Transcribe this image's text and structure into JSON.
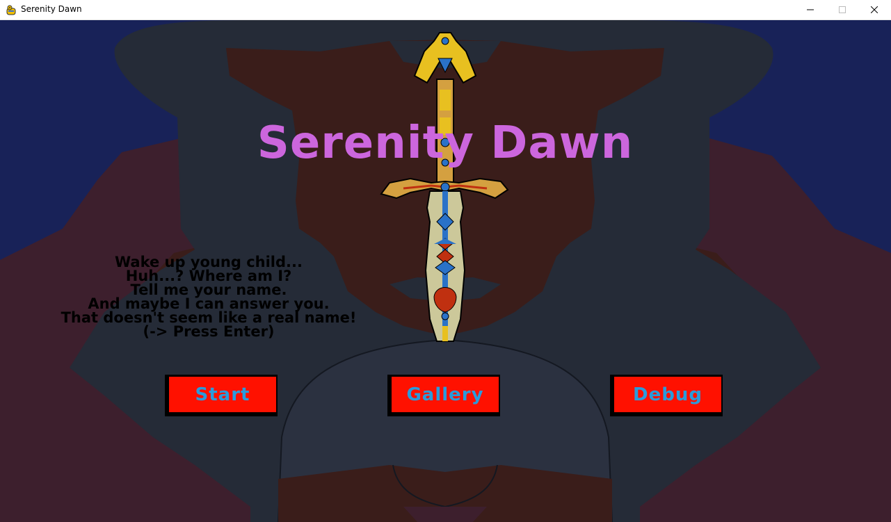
{
  "window": {
    "title": "Serenity Dawn",
    "icon": "pygame-snake-icon",
    "controls": [
      "minimize-icon",
      "maximize-icon",
      "close-icon"
    ]
  },
  "game": {
    "title": "Serenity Dawn",
    "dialogue": [
      "Wake up young child...",
      "Huh...? Where am I?",
      "Tell me your name.",
      "And maybe I can answer you.",
      "That doesn't seem like a real name!",
      "(-> Press Enter)"
    ],
    "buttons": {
      "start": "Start",
      "gallery": "Gallery",
      "debug": "Debug"
    }
  },
  "colors": {
    "sky": "#182258",
    "outer_robe": "#3d1f2d",
    "inner_cloak": "#252b37",
    "hood": "#3a1d1a",
    "title": "#cc66dd",
    "button_fill": "#ff1100",
    "button_text": "#2a9bdc"
  }
}
